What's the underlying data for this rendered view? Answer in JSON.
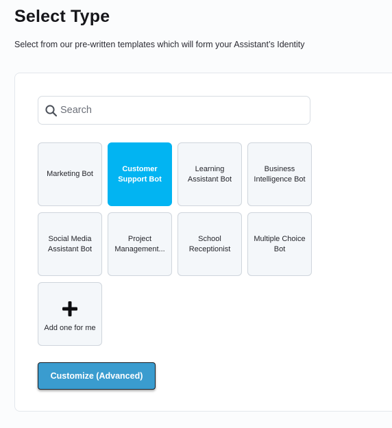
{
  "header": {
    "title": "Select Type",
    "subtitle": "Select from our pre-written templates which will form your Assistant’s Identity"
  },
  "search": {
    "placeholder": "Search",
    "value": "",
    "icon": "search-icon"
  },
  "templates": [
    {
      "label": "Marketing Bot",
      "selected": false
    },
    {
      "label": "Customer Support Bot",
      "selected": true
    },
    {
      "label": "Learning Assistant Bot",
      "selected": false
    },
    {
      "label": "Business Intelligence Bot",
      "selected": false
    },
    {
      "label": "Social Media Assistant Bot",
      "selected": false
    },
    {
      "label": "Project Management...",
      "selected": false
    },
    {
      "label": "School Receptionist",
      "selected": false
    },
    {
      "label": "Multiple Choice Bot",
      "selected": false
    }
  ],
  "add_tile": {
    "label": "Add one for me",
    "icon": "plus-icon"
  },
  "actions": {
    "customize_label": "Customize (Advanced)"
  },
  "colors": {
    "selected_tile": "#02b4f2",
    "button": "#3a9ccf",
    "tile_bg": "#f4f7fa"
  }
}
